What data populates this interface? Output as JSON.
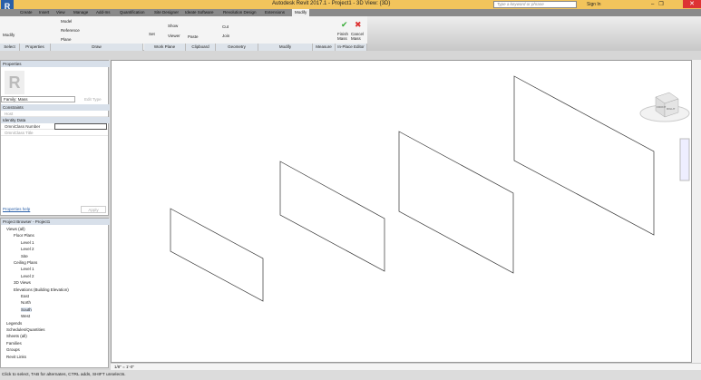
{
  "app": {
    "title": "Autodesk Revit 2017.1 -    Project1 - 3D View: {3D}",
    "logo": "R",
    "search_placeholder": "Type a keyword or phrase",
    "sign_in": "Sign In"
  },
  "tabs": [
    "Create",
    "Insert",
    "View",
    "Manage",
    "Add-Ins",
    "Quantification",
    "Site Designer",
    "Ideate Software",
    "Revolution Design",
    "Extensions",
    "Modify"
  ],
  "active_tab": "Modify",
  "ribbon": {
    "panels": [
      "Select",
      "Properties",
      "Draw",
      "Work Plane",
      "Clipboard",
      "Geometry",
      "Modify",
      "Measure",
      "In-Place Editor"
    ],
    "modify": "Modify",
    "model": "Model",
    "reference": "Reference",
    "plane": "Plane",
    "set": "Set",
    "show": "Show",
    "viewer": "Viewer",
    "paste": "Paste",
    "cut": "Cut",
    "join": "Join",
    "finish_mass": "Finish Mass",
    "cancel_mass": "Cancel Mass"
  },
  "properties": {
    "title": "Properties",
    "family": "Family: Mass",
    "edit_type": "Edit Type",
    "sections": [
      {
        "name": "Constraints",
        "rows": [
          {
            "label": "Host",
            "value": ""
          }
        ]
      },
      {
        "name": "Identity Data",
        "rows": [
          {
            "label": "OmniClass Number",
            "value": ""
          },
          {
            "label": "OmniClass Title",
            "value": ""
          }
        ]
      }
    ],
    "help": "Properties help",
    "apply": "Apply"
  },
  "browser": {
    "title": "Project Browser - Project1",
    "items": [
      {
        "label": "Views (all)",
        "level": 0
      },
      {
        "label": "Floor Plans",
        "level": 1
      },
      {
        "label": "Level 1",
        "level": 2
      },
      {
        "label": "Level 2",
        "level": 2
      },
      {
        "label": "Site",
        "level": 2
      },
      {
        "label": "Ceiling Plans",
        "level": 1
      },
      {
        "label": "Level 1",
        "level": 2
      },
      {
        "label": "Level 2",
        "level": 2
      },
      {
        "label": "3D Views",
        "level": 1
      },
      {
        "label": "Elevations (Building Elevation)",
        "level": 1
      },
      {
        "label": "East",
        "level": 2
      },
      {
        "label": "North",
        "level": 2
      },
      {
        "label": "South",
        "level": 2,
        "selected": true
      },
      {
        "label": "West",
        "level": 2
      },
      {
        "label": "Legends",
        "level": 0
      },
      {
        "label": "Schedules/Quantities",
        "level": 0
      },
      {
        "label": "Sheets (all)",
        "level": 0
      },
      {
        "label": "Families",
        "level": 0
      },
      {
        "label": "Groups",
        "level": 0
      },
      {
        "label": "Revit Links",
        "level": 0
      }
    ]
  },
  "viewcube": {
    "front": "FRONT",
    "right": "RIGHT",
    "top": "TOP"
  },
  "viewbar": {
    "scale": "1/8\" = 1'-0\""
  },
  "status": {
    "text": "Click to select, TAB for alternates, CTRL adds, SHIFT unselects.",
    "filter_count": ":0"
  },
  "colors": {
    "titlebar": "#f2c45c",
    "accent": "#2a5fa8",
    "close": "#dd3333"
  }
}
